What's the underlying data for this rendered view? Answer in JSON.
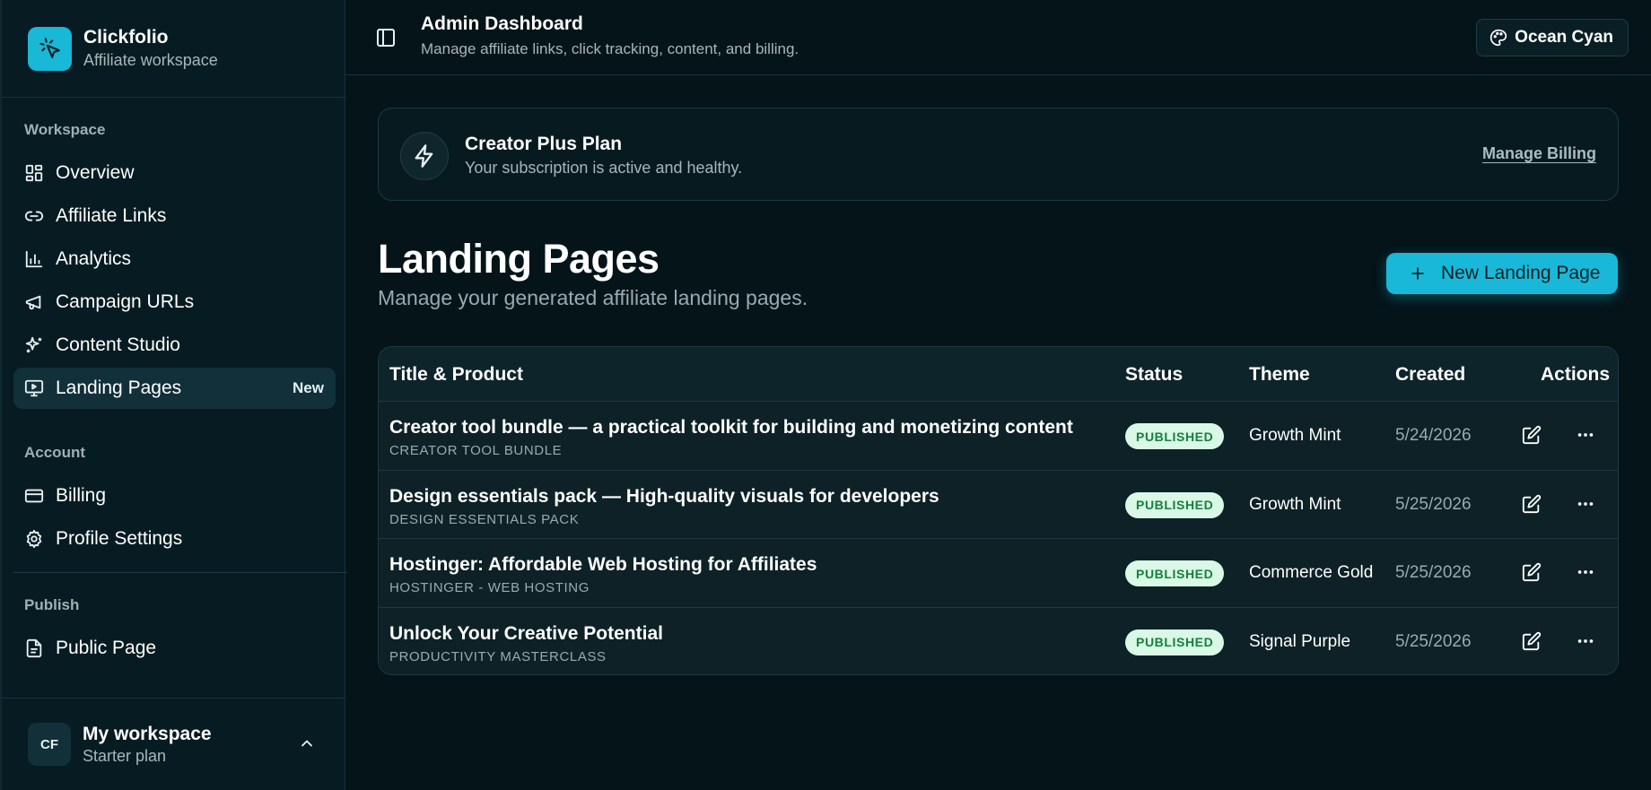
{
  "sidebar": {
    "brand": {
      "name": "Clickfolio",
      "subtitle": "Affiliate workspace"
    },
    "sections": [
      {
        "label": "Workspace"
      },
      {
        "label": "Account"
      },
      {
        "label": "Publish"
      }
    ],
    "items": [
      {
        "label": "Overview",
        "icon": "grid-icon"
      },
      {
        "label": "Affiliate Links",
        "icon": "link-icon"
      },
      {
        "label": "Analytics",
        "icon": "bar-chart-icon"
      },
      {
        "label": "Campaign URLs",
        "icon": "megaphone-icon"
      },
      {
        "label": "Content Studio",
        "icon": "sparkles-icon"
      },
      {
        "label": "Landing Pages",
        "icon": "monitor-play-icon",
        "badge": "New",
        "active": true
      },
      {
        "label": "Billing",
        "icon": "credit-card-icon"
      },
      {
        "label": "Profile Settings",
        "icon": "gear-icon"
      },
      {
        "label": "Public Page",
        "icon": "document-icon"
      }
    ],
    "workspace": {
      "initials": "CF",
      "name": "My workspace",
      "plan": "Starter plan"
    }
  },
  "header": {
    "title": "Admin Dashboard",
    "subtitle": "Manage affiliate links, click tracking, content, and billing.",
    "theme_label": "Ocean Cyan"
  },
  "plan_card": {
    "title": "Creator Plus Plan",
    "subtitle": "Your subscription is active and healthy.",
    "link": "Manage Billing"
  },
  "page": {
    "title": "Landing Pages",
    "subtitle": "Manage your generated affiliate landing pages.",
    "new_button": "New Landing Page"
  },
  "table": {
    "columns": [
      "Title & Product",
      "Status",
      "Theme",
      "Created",
      "Actions"
    ],
    "rows": [
      {
        "title": "Creator tool bundle — a practical toolkit for building and monetizing content",
        "product": "CREATOR TOOL BUNDLE",
        "status": "PUBLISHED",
        "theme": "Growth Mint",
        "created": "5/24/2026"
      },
      {
        "title": "Design essentials pack — High-quality visuals for developers",
        "product": "DESIGN ESSENTIALS PACK",
        "status": "PUBLISHED",
        "theme": "Growth Mint",
        "created": "5/25/2026"
      },
      {
        "title": "Hostinger: Affordable Web Hosting for Affiliates",
        "product": "HOSTINGER - WEB HOSTING",
        "status": "PUBLISHED",
        "theme": "Commerce Gold",
        "created": "5/25/2026"
      },
      {
        "title": "Unlock Your Creative Potential",
        "product": "PRODUCTIVITY MASTERCLASS",
        "status": "PUBLISHED",
        "theme": "Signal Purple",
        "created": "5/25/2026"
      }
    ]
  },
  "colors": {
    "accent": "#1ab8d8",
    "background": "#041419",
    "sidebar": "#071c22",
    "status_published_bg": "#d9f8e6",
    "status_published_text": "#15803d"
  }
}
